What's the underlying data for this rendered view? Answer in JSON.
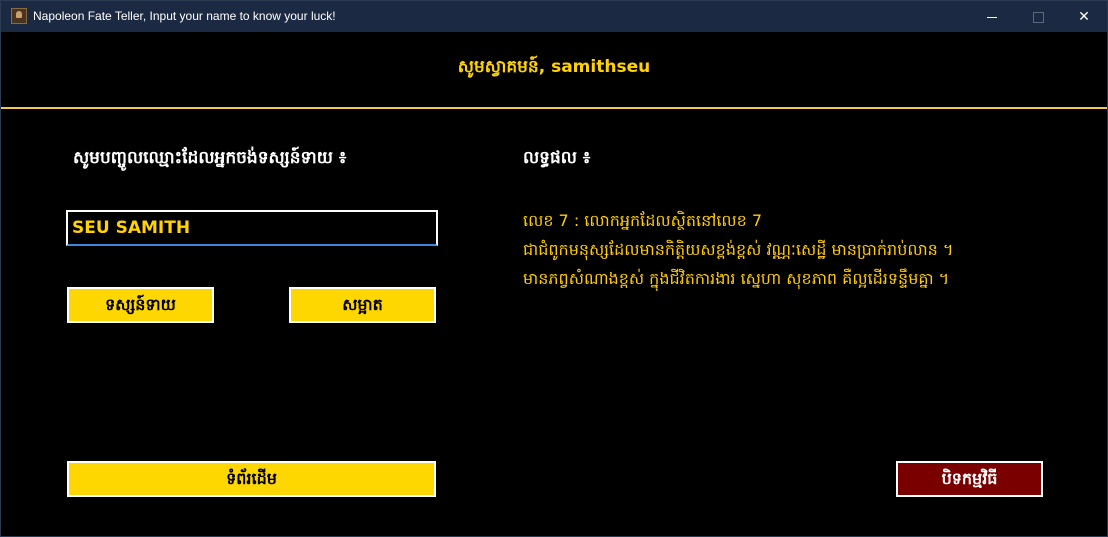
{
  "window": {
    "title": "Napoleon Fate Teller, Input your name to know your luck!",
    "icon": "app-portrait-icon",
    "controls": {
      "minimize_icon": "minimize-icon",
      "maximize_icon": "maximize-icon",
      "close_glyph": "✕"
    }
  },
  "header": {
    "welcome": "សូមស្វាគមន៍, samithseu"
  },
  "left_panel": {
    "heading": "សូមបញ្ចូលឈ្មោះដែលអ្នកចង់ទស្សន៍ទាយ ៖",
    "name_input_value": "SEU SAMITH",
    "predict_button": "ទស្សន៍ទាយ",
    "clear_button": "សម្អាត",
    "home_button": "ទំព័រដើម"
  },
  "right_panel": {
    "heading": "លទ្ធផល ៖",
    "result_lines": [
      "លេខ 7 : លោកអ្នកដែលស្ថិតនៅលេខ 7",
      "ជាជំពូកមនុស្សដែលមានកិត្តិយសខ្ពង់ខ្ពស់ វណ្ណៈសេដ្ឋី មានប្រាក់រាប់លាន ។",
      "មានភព្វសំណាងខ្ពស់ ក្នុងជីវិតការងារ ស្នេហា សុខភាព គឺល្អដើរទន្ទឹមគ្នា ។"
    ],
    "exit_button": "បិទកម្មវិធី"
  },
  "colors": {
    "background": "#000000",
    "accent_yellow": "#ffd700",
    "result_text": "#ffcc00",
    "exit_button": "#7a0000",
    "titlebar": "#1b2a42"
  }
}
